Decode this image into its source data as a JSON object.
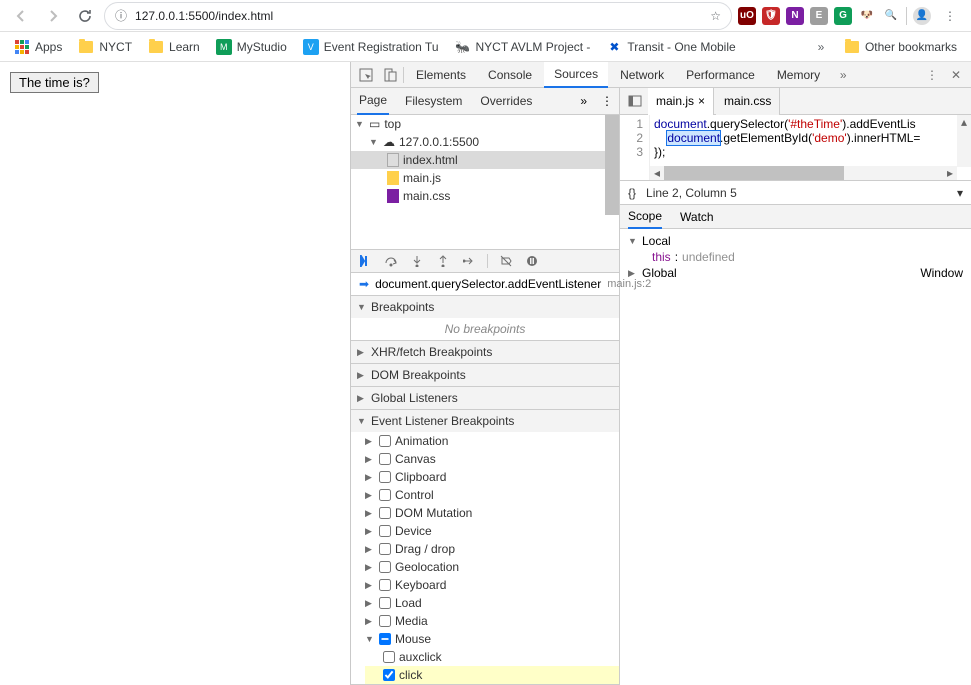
{
  "browser": {
    "url": "127.0.0.1:5500/index.html",
    "extensions": [
      "uO",
      "shield",
      "N",
      "E",
      "G",
      "dog",
      "search",
      "sep",
      "avatar"
    ],
    "bookmarks": [
      "Apps",
      "NYCT",
      "Learn",
      "MyStudio",
      "Event Registration Tu",
      "NYCT AVLM Project -",
      "Transit - One Mobile"
    ],
    "other_bookmarks": "Other bookmarks"
  },
  "page": {
    "button": "The time is?"
  },
  "devtools": {
    "tabs": [
      "Elements",
      "Console",
      "Sources",
      "Network",
      "Performance",
      "Memory"
    ],
    "subtabs": [
      "Page",
      "Filesystem",
      "Overrides"
    ],
    "tree": {
      "top": "top",
      "host": "127.0.0.1:5500",
      "files": [
        "index.html",
        "main.js",
        "main.css"
      ]
    },
    "paused": {
      "text": "document.querySelector.addEventListener",
      "loc": "main.js:2"
    },
    "sections": {
      "breakpoints": "Breakpoints",
      "no_bp": "No breakpoints",
      "xhr": "XHR/fetch Breakpoints",
      "dom": "DOM Breakpoints",
      "global": "Global Listeners",
      "evlisten": "Event Listener Breakpoints"
    },
    "event_cats": [
      "Animation",
      "Canvas",
      "Clipboard",
      "Control",
      "DOM Mutation",
      "Device",
      "Drag / drop",
      "Geolocation",
      "Keyboard",
      "Load",
      "Media",
      "Mouse"
    ],
    "mouse_events": [
      "auxclick",
      "click"
    ],
    "editor_tabs": [
      "main.js",
      "main.css"
    ],
    "code": {
      "l1a": "document",
      "l1b": ".querySelector(",
      "l1c": "'#theTime'",
      "l1d": ").addEventLis",
      "l2a": "document",
      "l2b": ".getElementById(",
      "l2c": "'demo'",
      "l2d": ").innerHTML=",
      "l3": "});"
    },
    "status": "Line 2, Column 5",
    "scope_tabs": [
      "Scope",
      "Watch"
    ],
    "scopes": {
      "local": "Local",
      "this": "this",
      "this_v": "undefined",
      "global": "Global",
      "global_v": "Window"
    }
  }
}
